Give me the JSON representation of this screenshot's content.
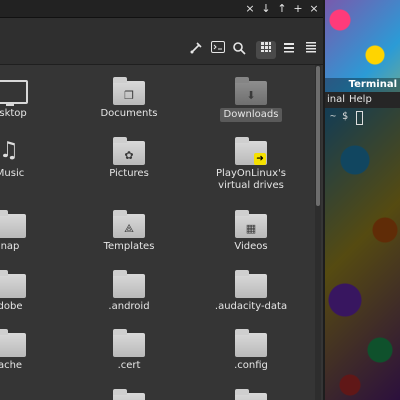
{
  "window_controls": [
    "×",
    "↓",
    "↑",
    "+",
    "×"
  ],
  "toolbar": {
    "icons": [
      "path-edit-icon",
      "terminal-icon",
      "search-icon",
      "grid-view-icon",
      "list-view-icon",
      "compact-view-icon"
    ]
  },
  "files": [
    {
      "label": "esktop",
      "icon": "monitor-icon"
    },
    {
      "label": "Documents",
      "icon": "documents-folder-icon"
    },
    {
      "label": "Downloads",
      "icon": "downloads-folder-icon",
      "selected": true
    },
    {
      "label": "Music",
      "icon": "music-icon"
    },
    {
      "label": "Pictures",
      "icon": "pictures-folder-icon"
    },
    {
      "label": "PlayOnLinux's virtual drives",
      "icon": "playonlinux-folder-icon"
    },
    {
      "label": "nap",
      "icon": "folder-icon"
    },
    {
      "label": "Templates",
      "icon": "templates-folder-icon"
    },
    {
      "label": "Videos",
      "icon": "videos-folder-icon"
    },
    {
      "label": "dobe",
      "icon": "folder-icon"
    },
    {
      "label": ".android",
      "icon": "folder-icon"
    },
    {
      "label": ".audacity-data",
      "icon": "folder-icon"
    },
    {
      "label": "ache",
      "icon": "folder-icon"
    },
    {
      "label": ".cert",
      "icon": "folder-icon"
    },
    {
      "label": ".config",
      "icon": "folder-icon"
    }
  ],
  "terminal": {
    "title": "Terminal",
    "menu": [
      "inal",
      "Help"
    ],
    "prompt": "~ $"
  }
}
